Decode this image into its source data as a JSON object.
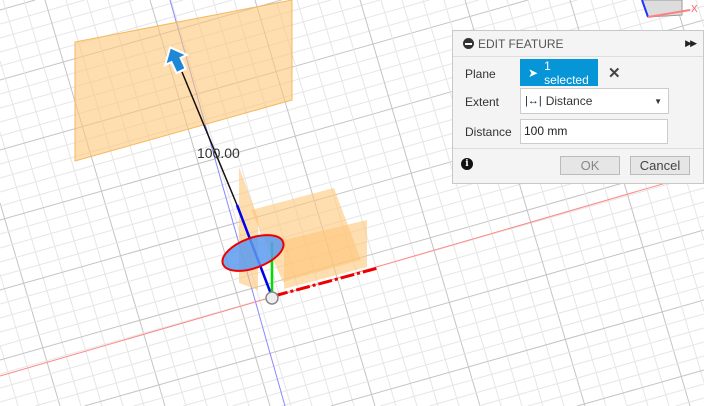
{
  "viewport": {
    "dimension_label": "100.00",
    "viewcube_axis": "X"
  },
  "dialog": {
    "title": "EDIT FEATURE",
    "plane_label": "Plane",
    "plane_value": "1 selected",
    "extent_label": "Extent",
    "extent_value": "Distance",
    "distance_label": "Distance",
    "distance_value": "100 mm",
    "ok_label": "OK",
    "cancel_label": "Cancel"
  },
  "colors": {
    "accent": "#0696d7",
    "plane": "#fdc77a",
    "x_axis": "#ff0000",
    "y_axis": "#00cc00",
    "z_axis": "#0000ff"
  }
}
